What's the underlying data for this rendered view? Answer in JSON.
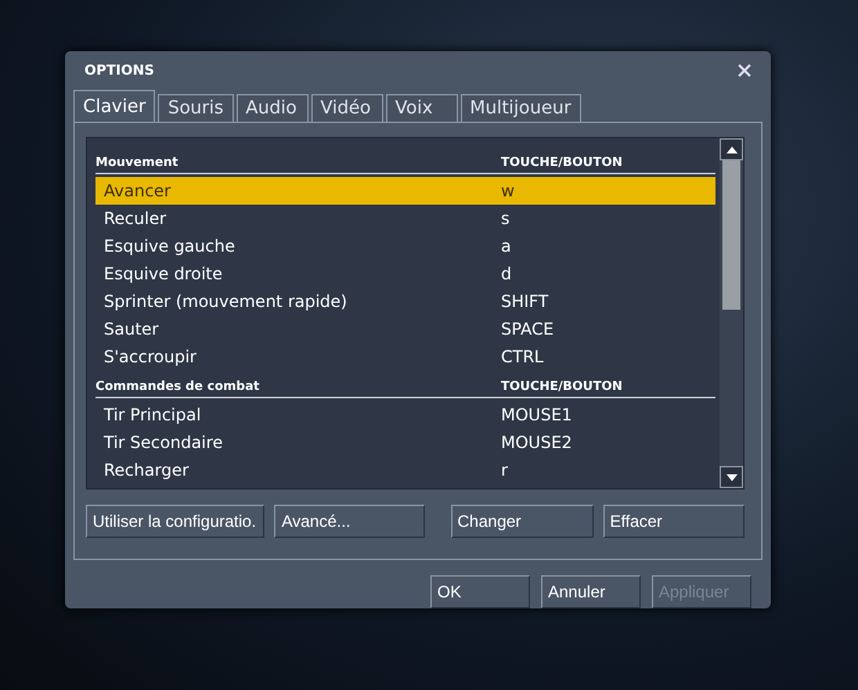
{
  "window": {
    "title": "OPTIONS"
  },
  "tabs": [
    {
      "label": "Clavier",
      "selected": true
    },
    {
      "label": "Souris",
      "selected": false
    },
    {
      "label": "Audio",
      "selected": false
    },
    {
      "label": "Vidéo",
      "selected": false
    },
    {
      "label": "Voix",
      "selected": false
    },
    {
      "label": "Multijoueur",
      "selected": false
    }
  ],
  "sections": [
    {
      "header": "Mouvement",
      "key_header": "TOUCHE/BOUTON",
      "rows": [
        {
          "action": "Avancer",
          "key": "w",
          "selected": true
        },
        {
          "action": "Reculer",
          "key": "s",
          "selected": false
        },
        {
          "action": "Esquive gauche",
          "key": "a",
          "selected": false
        },
        {
          "action": "Esquive droite",
          "key": "d",
          "selected": false
        },
        {
          "action": "Sprinter (mouvement rapide)",
          "key": "SHIFT",
          "selected": false
        },
        {
          "action": "Sauter",
          "key": "SPACE",
          "selected": false
        },
        {
          "action": "S'accroupir",
          "key": "CTRL",
          "selected": false
        }
      ]
    },
    {
      "header": "Commandes de combat",
      "key_header": "TOUCHE/BOUTON",
      "rows": [
        {
          "action": "Tir Principal",
          "key": "MOUSE1",
          "selected": false
        },
        {
          "action": "Tir Secondaire",
          "key": "MOUSE2",
          "selected": false
        },
        {
          "action": "Recharger",
          "key": "r",
          "selected": false
        }
      ]
    }
  ],
  "panel_buttons": [
    {
      "label": "Utiliser la configuratio.",
      "disabled": false
    },
    {
      "label": "Avancé...",
      "disabled": false
    },
    {
      "label": "Changer",
      "disabled": false
    },
    {
      "label": "Effacer",
      "disabled": false
    }
  ],
  "dialog_buttons": [
    {
      "label": "OK",
      "disabled": false
    },
    {
      "label": "Annuler",
      "disabled": false
    },
    {
      "label": "Appliquer",
      "disabled": true
    }
  ]
}
